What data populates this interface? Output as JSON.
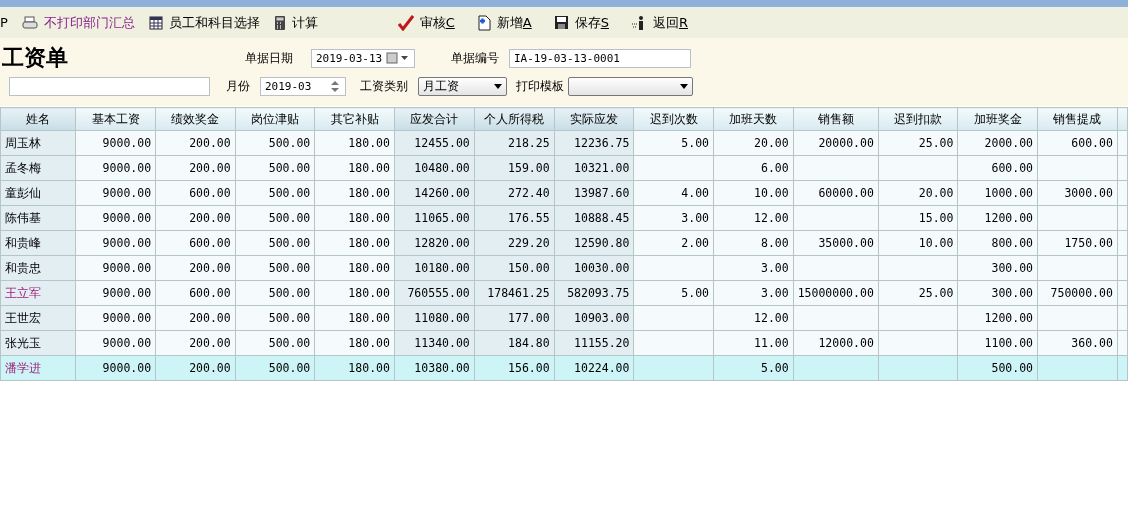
{
  "toolbar_left": [
    {
      "kind": "text",
      "label": "P"
    },
    {
      "kind": "printer",
      "label": "不打印部门汇总",
      "highlight": true
    },
    {
      "kind": "grid",
      "label": "员工和科目选择",
      "highlight": false
    },
    {
      "kind": "calc",
      "label": "计算",
      "highlight": false
    }
  ],
  "toolbar_right": [
    {
      "kind": "check",
      "label": "审核",
      "key": "C"
    },
    {
      "kind": "new",
      "label": "新增",
      "key": "A"
    },
    {
      "kind": "save",
      "label": "保存",
      "key": "S"
    },
    {
      "kind": "back",
      "label": "返回",
      "key": "R"
    }
  ],
  "form": {
    "title": "工资单",
    "date_label": "单据日期",
    "date": "2019-03-13",
    "number_label": "单据编号",
    "number": "IA-19-03-13-0001",
    "month_label": "月份",
    "month": "2019-03",
    "type_label": "工资类别",
    "type": "月工资",
    "template_label": "打印模板"
  },
  "table": {
    "columns": [
      {
        "label": "姓名",
        "shaded": true
      },
      {
        "label": "基本工资",
        "shaded": false
      },
      {
        "label": "绩效奖金",
        "shaded": false
      },
      {
        "label": "岗位津贴",
        "shaded": false
      },
      {
        "label": "其它补贴",
        "shaded": false
      },
      {
        "label": "应发合计",
        "shaded": true
      },
      {
        "label": "个人所得税",
        "shaded": true
      },
      {
        "label": "实际应发",
        "shaded": true
      },
      {
        "label": "迟到次数",
        "shaded": false
      },
      {
        "label": "加班天数",
        "shaded": false
      },
      {
        "label": "销售额",
        "shaded": false
      },
      {
        "label": "迟到扣款",
        "shaded": false
      },
      {
        "label": "加班奖金",
        "shaded": false
      },
      {
        "label": "销售提成",
        "shaded": false
      }
    ],
    "rows": [
      {
        "flagged": false,
        "selected": false,
        "cells": [
          "周玉林",
          "9000.00",
          "200.00",
          "500.00",
          "180.00",
          "12455.00",
          "218.25",
          "12236.75",
          "5.00",
          "20.00",
          "20000.00",
          "25.00",
          "2000.00",
          "600.00"
        ]
      },
      {
        "flagged": false,
        "selected": false,
        "cells": [
          "孟冬梅",
          "9000.00",
          "200.00",
          "500.00",
          "180.00",
          "10480.00",
          "159.00",
          "10321.00",
          null,
          "6.00",
          null,
          null,
          "600.00",
          null
        ]
      },
      {
        "flagged": false,
        "selected": false,
        "cells": [
          "童彭仙",
          "9000.00",
          "600.00",
          "500.00",
          "180.00",
          "14260.00",
          "272.40",
          "13987.60",
          "4.00",
          "10.00",
          "60000.00",
          "20.00",
          "1000.00",
          "3000.00"
        ]
      },
      {
        "flagged": false,
        "selected": false,
        "cells": [
          "陈伟基",
          "9000.00",
          "200.00",
          "500.00",
          "180.00",
          "11065.00",
          "176.55",
          "10888.45",
          "3.00",
          "12.00",
          null,
          "15.00",
          "1200.00",
          null
        ]
      },
      {
        "flagged": false,
        "selected": false,
        "cells": [
          "和贵峰",
          "9000.00",
          "600.00",
          "500.00",
          "180.00",
          "12820.00",
          "229.20",
          "12590.80",
          "2.00",
          "8.00",
          "35000.00",
          "10.00",
          "800.00",
          "1750.00"
        ]
      },
      {
        "flagged": false,
        "selected": false,
        "cells": [
          "和贵忠",
          "9000.00",
          "200.00",
          "500.00",
          "180.00",
          "10180.00",
          "150.00",
          "10030.00",
          null,
          "3.00",
          null,
          null,
          "300.00",
          null
        ]
      },
      {
        "flagged": true,
        "selected": false,
        "cells": [
          "王立军",
          "9000.00",
          "600.00",
          "500.00",
          "180.00",
          "760555.00",
          "178461.25",
          "582093.75",
          "5.00",
          "3.00",
          "15000000.00",
          "25.00",
          "300.00",
          "750000.00"
        ]
      },
      {
        "flagged": false,
        "selected": false,
        "cells": [
          "王世宏",
          "9000.00",
          "200.00",
          "500.00",
          "180.00",
          "11080.00",
          "177.00",
          "10903.00",
          null,
          "12.00",
          null,
          null,
          "1200.00",
          null
        ]
      },
      {
        "flagged": false,
        "selected": false,
        "cells": [
          "张光玉",
          "9000.00",
          "200.00",
          "500.00",
          "180.00",
          "11340.00",
          "184.80",
          "11155.20",
          null,
          "11.00",
          "12000.00",
          null,
          "1100.00",
          "360.00"
        ]
      },
      {
        "flagged": true,
        "selected": true,
        "cells": [
          "潘学进",
          "9000.00",
          "200.00",
          "500.00",
          "180.00",
          "10380.00",
          "156.00",
          "10224.00",
          null,
          "5.00",
          null,
          null,
          "500.00",
          null
        ]
      }
    ]
  }
}
